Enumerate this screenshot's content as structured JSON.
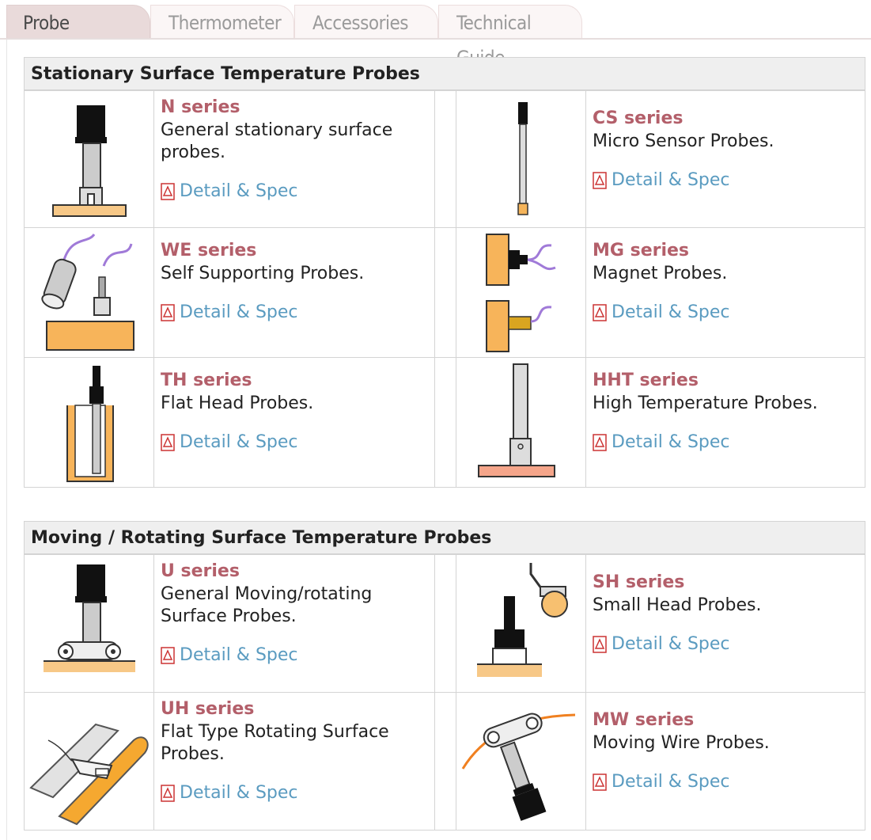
{
  "tabs": [
    {
      "label": "Probe",
      "active": true
    },
    {
      "label": "Thermometer",
      "active": false
    },
    {
      "label": "Accessories",
      "active": false
    },
    {
      "label": "Technical Guide",
      "active": false
    }
  ],
  "sections": [
    {
      "title": "Stationary Surface Temperature Probes",
      "items": [
        {
          "series": "N series",
          "desc": "General stationary surface probes.",
          "link": "Detail & Spec",
          "icon": "n-series-probe-icon"
        },
        {
          "series": "CS series",
          "desc": "Micro Sensor Probes.",
          "link": "Detail & Spec",
          "icon": "cs-series-probe-icon"
        },
        {
          "series": "WE series",
          "desc": "Self Supporting Probes.",
          "link": "Detail & Spec",
          "icon": "we-series-probe-icon"
        },
        {
          "series": "MG series",
          "desc": "Magnet Probes.",
          "link": "Detail & Spec",
          "icon": "mg-series-probe-icon"
        },
        {
          "series": "TH series",
          "desc": "Flat Head Probes.",
          "link": "Detail & Spec",
          "icon": "th-series-probe-icon"
        },
        {
          "series": "HHT series",
          "desc": "High Temperature Probes.",
          "link": "Detail & Spec",
          "icon": "hht-series-probe-icon"
        }
      ]
    },
    {
      "title": "Moving / Rotating Surface Temperature Probes",
      "items": [
        {
          "series": "U series",
          "desc": "General Moving/rotating Surface Probes.",
          "link": "Detail & Spec",
          "icon": "u-series-probe-icon"
        },
        {
          "series": "SH series",
          "desc": "Small Head Probes.",
          "link": "Detail & Spec",
          "icon": "sh-series-probe-icon"
        },
        {
          "series": "UH series",
          "desc": "Flat Type Rotating Surface Probes.",
          "link": "Detail & Spec",
          "icon": "uh-series-probe-icon"
        },
        {
          "series": "MW series",
          "desc": "Moving Wire Probes.",
          "link": "Detail & Spec",
          "icon": "mw-series-probe-icon"
        }
      ]
    }
  ],
  "colors": {
    "accent": "#b35f6a",
    "link": "#5a9bc0",
    "header_bg": "#efefef",
    "orange": "#f5a94a"
  }
}
